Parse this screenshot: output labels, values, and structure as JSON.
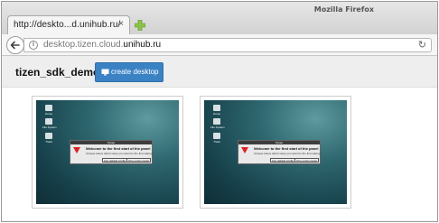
{
  "window": {
    "title": "Mozilla Firefox"
  },
  "tab": {
    "title": "http://deskto...d.unihub.ru/",
    "close": "×"
  },
  "urlbar": {
    "prefix": "desktop.tizen.cloud.",
    "host": "unihub.ru",
    "info": "i",
    "reload": "↻"
  },
  "app": {
    "title": "tizen_sdk_demo",
    "create_button": "create desktop"
  },
  "colors": {
    "accent": "#3b82c4",
    "new_tab_plus": "#8bc34a"
  },
  "desktops": [
    {
      "icons": [
        "Home",
        "File System",
        "Trash"
      ],
      "dialog": {
        "header": "Panel",
        "title": "Welcome to the first start of the panel",
        "text": "Choose below which setup you want for the first startup.",
        "btn_default": "Use default config",
        "btn_empty": "One empty panel"
      }
    },
    {
      "icons": [
        "Home",
        "File System",
        "Trash"
      ],
      "dialog": {
        "header": "Panel",
        "title": "Welcome to the first start of the panel",
        "text": "Choose below which setup you want for the first startup.",
        "btn_default": "Use default config",
        "btn_empty": "One empty panel"
      }
    }
  ]
}
